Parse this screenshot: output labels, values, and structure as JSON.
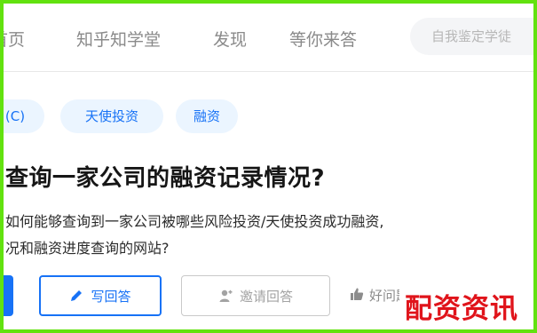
{
  "nav": {
    "items": [
      "首页",
      "知乎知学堂",
      "发现",
      "等你来答"
    ]
  },
  "search": {
    "placeholder": "自我鉴定学徒"
  },
  "tags": [
    "(C)",
    "天使投资",
    "融资"
  ],
  "question": {
    "title": "查询一家公司的融资记录情况?",
    "detail_line_1": "如何能够查询到一家公司被哪些风险投资/天使投资成功融资,",
    "detail_line_2": "况和融资进度查询的网站?"
  },
  "actions": {
    "answer_label": "写回答",
    "invite_label": "邀请回答",
    "good_question_label": "好问题"
  },
  "watermark": "配资资讯",
  "colors": {
    "frame": "#62e20f",
    "accent": "#1772f6",
    "tag_bg": "#ebf5ff",
    "watermark": "#e0141b"
  },
  "icons": [
    "pencil-icon",
    "invite-user-icon",
    "thumbs-up-icon"
  ]
}
